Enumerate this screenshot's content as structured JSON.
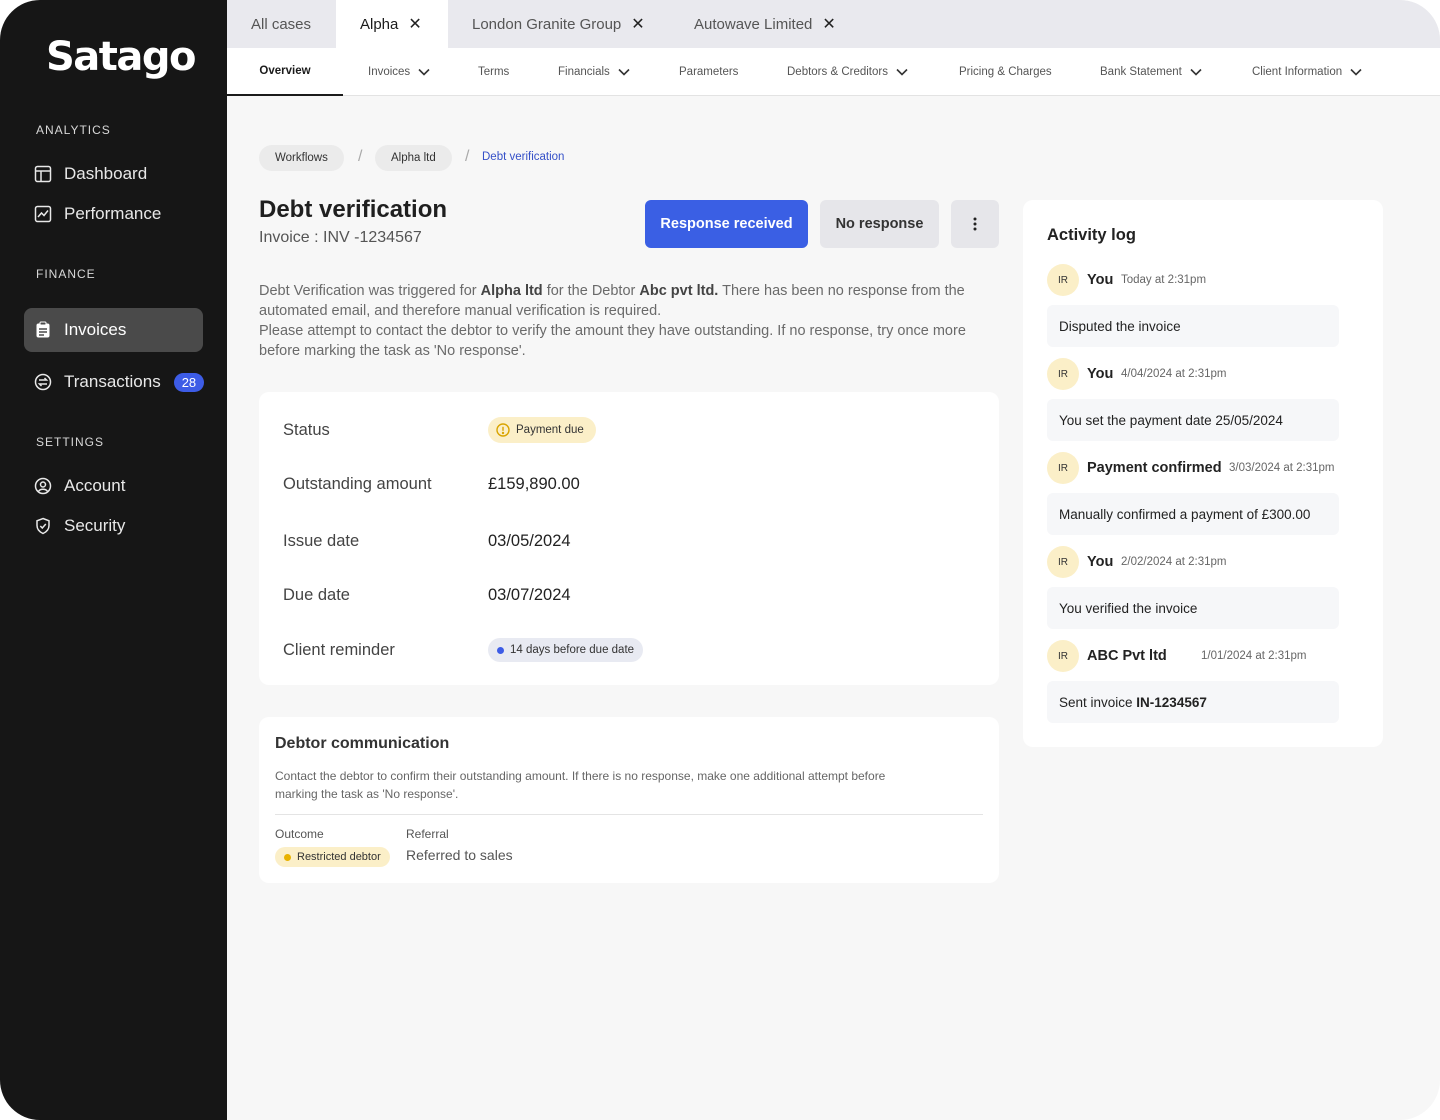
{
  "brand": {
    "logo": "Satago"
  },
  "sidebar": {
    "sections": {
      "analytics": "ANALYTICS",
      "finance": "FINANCE",
      "settings": "SETTINGS"
    },
    "items": [
      {
        "label": "Dashboard",
        "icon": "layout-icon"
      },
      {
        "label": "Performance",
        "icon": "chart-icon"
      },
      {
        "label": "Invoices",
        "icon": "clipboard-icon",
        "active": true
      },
      {
        "label": "Transactions",
        "icon": "exchange-icon",
        "badge": "28"
      },
      {
        "label": "Account",
        "icon": "user-circle-icon"
      },
      {
        "label": "Security",
        "icon": "shield-icon"
      }
    ]
  },
  "tabs": {
    "all_cases": "All cases",
    "open": [
      "Alpha",
      "London Granite Group",
      "Autowave Limited"
    ],
    "active": "Alpha"
  },
  "subnav": [
    "Overview",
    "Invoices",
    "Terms",
    "Financials",
    "Parameters",
    "Debtors & Creditors",
    "Pricing & Charges",
    "Bank Statement",
    "Client Information"
  ],
  "breadcrumb": {
    "items": [
      "Workflows",
      "Alpha ltd"
    ],
    "current": "Debt verification",
    "separator": "/"
  },
  "header": {
    "title": "Debt verification",
    "subtitle": "Invoice : INV -1234567",
    "primary_button": "Response received",
    "secondary_button": "No response",
    "more_button": "⋮"
  },
  "description": {
    "p1_a": "Debt Verification was triggered for ",
    "p1_client": "Alpha ltd",
    "p1_b": " for the Debtor ",
    "p1_debtor": "Abc pvt ltd.",
    "p1_c": " There has been no response from the automated email, and therefore manual verification is required.",
    "p2": "Please attempt to contact the debtor to verify the amount they have outstanding. If no response, try once more before marking the task as 'No response'."
  },
  "details": {
    "status_label": "Status",
    "status_value": "Payment due",
    "amount_label": "Outstanding amount",
    "amount_value": "£159,890.00",
    "issue_label": "Issue date",
    "issue_value": "03/05/2024",
    "due_label": "Due date",
    "due_value": "03/07/2024",
    "reminder_label": "Client reminder",
    "reminder_value": "14 days before due date"
  },
  "communication": {
    "title": "Debtor communication",
    "text": "Contact the debtor to confirm their outstanding amount. If there is no response, make one additional attempt before marking the task as 'No response'.",
    "outcome_label": "Outcome",
    "outcome_value": "Restricted debtor",
    "referral_label": "Referral",
    "referral_value": "Referred to sales"
  },
  "activity_log": {
    "title": "Activity log",
    "entries": [
      {
        "initials": "IR",
        "name": "You",
        "time": "Today at 2:31pm",
        "message": "Disputed the invoice"
      },
      {
        "initials": "IR",
        "name": "You",
        "time": "4/04/2024 at 2:31pm",
        "message": "You set the payment date 25/05/2024"
      },
      {
        "initials": "IR",
        "name": "Payment confirmed",
        "time": "3/03/2024 at 2:31pm",
        "message": "Manually confirmed a payment of £300.00"
      },
      {
        "initials": "IR",
        "name": "You",
        "time": "2/02/2024 at 2:31pm",
        "message": "You verified the invoice"
      },
      {
        "initials": "IR",
        "name": "ABC Pvt ltd",
        "time": "1/01/2024 at 2:31pm",
        "message_prefix": "Sent invoice ",
        "message_bold": "IN-1234567"
      }
    ]
  },
  "colors": {
    "sidebar_bg": "#161616",
    "accent": "#3a5fe4",
    "badge": "#3d5ce6",
    "warning_pill": "#fbefc8",
    "info_dot": "#3d5ce6",
    "outcome_dot": "#e8b200"
  }
}
